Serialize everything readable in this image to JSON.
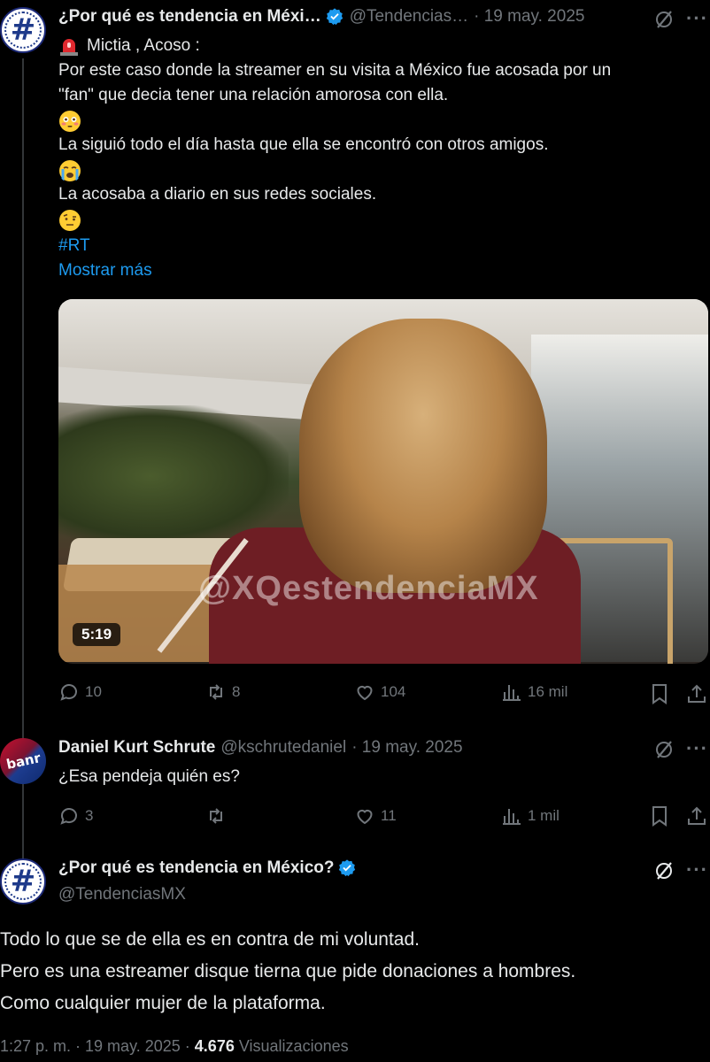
{
  "tweet1": {
    "name": "¿Por qué es tendencia en Méxi…",
    "handle": "@Tendencias…",
    "date": "· 19 may. 2025",
    "lines": [
      "Mictia , Acoso :",
      "Por este caso donde la streamer en su visita a México fue acosada por un",
      "\"fan\" que decia tener una relación amorosa con ella.",
      "La siguió todo el día hasta que ella se encontró con otros amigos.",
      "La acosaba a diario en sus redes sociales.",
      "#RT",
      "Mostrar más"
    ],
    "video_duration": "5:19",
    "watermark": "@XQestendenciaMX",
    "replies": "10",
    "retweets": "8",
    "likes": "104",
    "views": "16 mil"
  },
  "reply1": {
    "avatar_text": "banr",
    "name": "Daniel Kurt Schrute",
    "handle": "@kschrutedaniel",
    "date": "· 19 may. 2025",
    "text": "¿Esa pendeja quién es?",
    "replies": "3",
    "retweets": "",
    "likes": "11",
    "views": "1 mil"
  },
  "tweet2": {
    "name": "¿Por qué es tendencia en México?",
    "handle": "@TendenciasMX",
    "lines": [
      "Todo lo que se de ella es en contra de mi voluntad.",
      "Pero es una estreamer disque tierna que pide donaciones a hombres.",
      "Como cualquier mujer de la plataforma."
    ],
    "time": "1:27 p. m. · 19 may. 2025 ·",
    "views_count": "4.676",
    "views_label": "Visualizaciones"
  },
  "icons": [
    "verified-badge-icon",
    "grok-icon",
    "more-icon",
    "reply-icon",
    "retweet-icon",
    "like-icon",
    "views-icon",
    "bookmark-icon",
    "share-icon",
    "siren-emoji",
    "flushed-emoji",
    "crying-emoji",
    "raised-eyebrow-emoji"
  ],
  "colors": {
    "background": "#000000",
    "text": "#e7e9ea",
    "muted": "#71767b",
    "link": "#1d9bf0"
  }
}
